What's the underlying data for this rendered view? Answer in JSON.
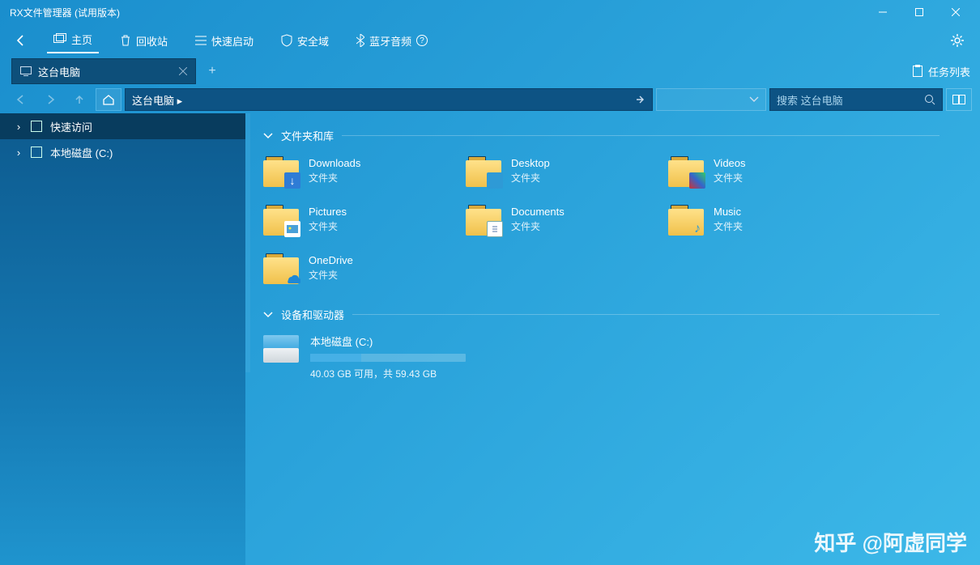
{
  "window": {
    "title": "RX文件管理器 (试用版本)"
  },
  "toolbar": {
    "home": "主页",
    "recycle": "回收站",
    "quicklaunch": "快速启动",
    "safezone": "安全域",
    "bluetooth": "蓝牙音频"
  },
  "tab": {
    "label": "这台电脑"
  },
  "tasks_label": "任务列表",
  "address": {
    "path": "这台电脑  ▸"
  },
  "search": {
    "placeholder": "搜索 这台电脑"
  },
  "sidebar": {
    "quick_access": "快速访问",
    "local_disk": "本地磁盘 (C:)"
  },
  "sections": {
    "folders": "文件夹和库",
    "drives": "设备和驱动器"
  },
  "folder_type": "文件夹",
  "folders": {
    "downloads": "Downloads",
    "desktop": "Desktop",
    "videos": "Videos",
    "pictures": "Pictures",
    "documents": "Documents",
    "music": "Music",
    "onedrive": "OneDrive"
  },
  "drive": {
    "name": "本地磁盘 (C:)",
    "stat": "40.03 GB 可用，共 59.43 GB",
    "free_gb": 40.03,
    "total_gb": 59.43
  },
  "watermark": "知乎 @阿虚同学"
}
